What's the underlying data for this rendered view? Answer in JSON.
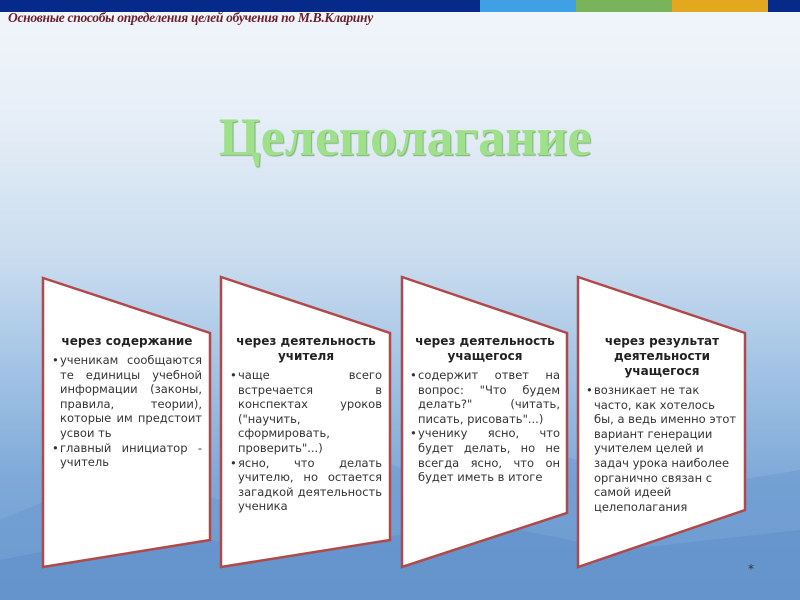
{
  "header": {
    "subtitle": "Основные способы определения целей обучения по М.В.Кларину",
    "accent_colors": [
      "#3fa0e3",
      "#79b35a",
      "#e3a81e"
    ]
  },
  "title": "Целеполагание",
  "cards": [
    {
      "heading": "через содержание",
      "items": [
        "ученикам сообщаются те единицы учебной информации (законы, правила, теории), которые им предстоит усвои ть",
        "главный инициатор - учитель"
      ]
    },
    {
      "heading": "через деятельность учителя",
      "items": [
        "чаще всего встречается в конспектах уроков (\"научить, сформировать, проверить\"...)",
        "ясно, что делать учителю, но остается загадкой деятельность ученика"
      ]
    },
    {
      "heading": "через деятельность учащегося",
      "items": [
        "содержит ответ на вопрос: \"Что будем делать?\" (читать, писать, рисовать\"...)",
        "ученику ясно, что будет делать, но не всегда ясно, что он будет иметь в итоге"
      ]
    },
    {
      "heading": "через результат деятельности учащегося",
      "items": [
        "возникает не так часто, как хотелось бы, а ведь именно этот вариант генерации учителем целей и задач урока наиболее органично связан с самой идеей целеполагания"
      ]
    }
  ],
  "footer": {
    "marker": "*"
  }
}
